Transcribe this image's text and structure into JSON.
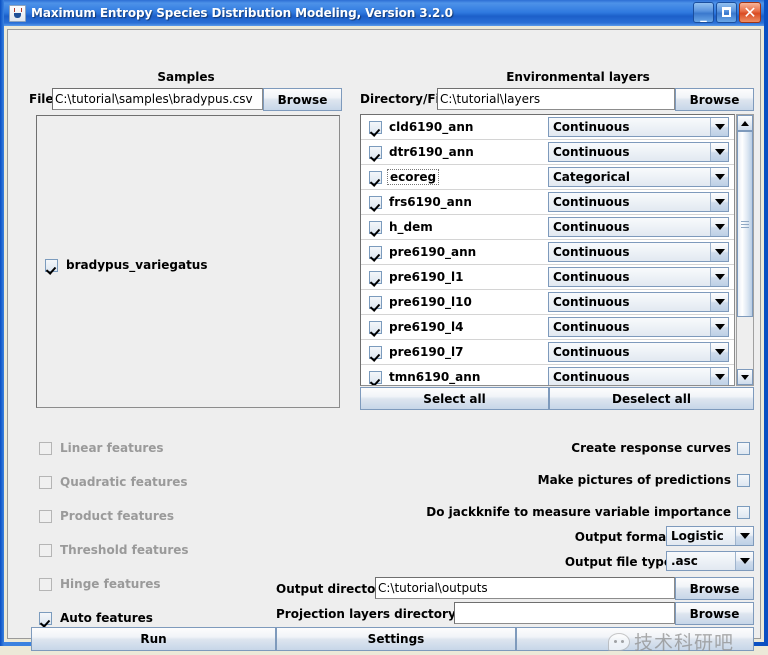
{
  "window": {
    "title": "Maximum Entropy Species Distribution Modeling, Version 3.2.0",
    "icon": "java-coffee-cup-icon",
    "minimize_label": "_",
    "maximize_label": "",
    "close_label": "✕"
  },
  "samples": {
    "section_title": "Samples",
    "file_label": "File",
    "file_value": "C:\\tutorial\\samples\\bradypus.csv",
    "browse_label": "Browse",
    "species": [
      {
        "name": "bradypus_variegatus",
        "checked": true
      }
    ]
  },
  "environmental_layers": {
    "section_title": "Environmental layers",
    "directory_label": "Directory/File",
    "directory_value": "C:\\tutorial\\layers",
    "browse_label": "Browse",
    "select_all_label": "Select all",
    "deselect_all_label": "Deselect all",
    "layers": [
      {
        "name": "cld6190_ann",
        "checked": true,
        "type": "Continuous",
        "focused": false
      },
      {
        "name": "dtr6190_ann",
        "checked": true,
        "type": "Continuous",
        "focused": false
      },
      {
        "name": "ecoreg",
        "checked": true,
        "type": "Categorical",
        "focused": true
      },
      {
        "name": "frs6190_ann",
        "checked": true,
        "type": "Continuous",
        "focused": false
      },
      {
        "name": "h_dem",
        "checked": true,
        "type": "Continuous",
        "focused": false
      },
      {
        "name": "pre6190_ann",
        "checked": true,
        "type": "Continuous",
        "focused": false
      },
      {
        "name": "pre6190_l1",
        "checked": true,
        "type": "Continuous",
        "focused": false
      },
      {
        "name": "pre6190_l10",
        "checked": true,
        "type": "Continuous",
        "focused": false
      },
      {
        "name": "pre6190_l4",
        "checked": true,
        "type": "Continuous",
        "focused": false
      },
      {
        "name": "pre6190_l7",
        "checked": true,
        "type": "Continuous",
        "focused": false
      },
      {
        "name": "tmn6190_ann",
        "checked": true,
        "type": "Continuous",
        "focused": false
      }
    ],
    "scroll_position_percent": 0
  },
  "features": [
    {
      "label": "Linear features",
      "checked": false,
      "enabled": false
    },
    {
      "label": "Quadratic features",
      "checked": false,
      "enabled": false
    },
    {
      "label": "Product features",
      "checked": false,
      "enabled": false
    },
    {
      "label": "Threshold features",
      "checked": false,
      "enabled": false
    },
    {
      "label": "Hinge features",
      "checked": false,
      "enabled": false
    },
    {
      "label": "Auto features",
      "checked": true,
      "enabled": true
    }
  ],
  "options": [
    {
      "label": "Create response curves",
      "checked": false
    },
    {
      "label": "Make pictures of predictions",
      "checked": false
    },
    {
      "label": "Do jackknife to measure variable importance",
      "checked": false
    }
  ],
  "output": {
    "format_label": "Output format",
    "format_value": "Logistic",
    "filetype_label": "Output file type",
    "filetype_value": ".asc",
    "directory_label": "Output directory",
    "directory_value": "C:\\tutorial\\outputs",
    "directory_browse_label": "Browse",
    "projection_label": "Projection layers directory/file",
    "projection_value": "",
    "projection_browse_label": "Browse"
  },
  "actions": {
    "run_label": "Run",
    "settings_label": "Settings",
    "help_label": ""
  },
  "watermark": {
    "text": "技术科研吧",
    "icon": "wechat-bubble-icon"
  }
}
